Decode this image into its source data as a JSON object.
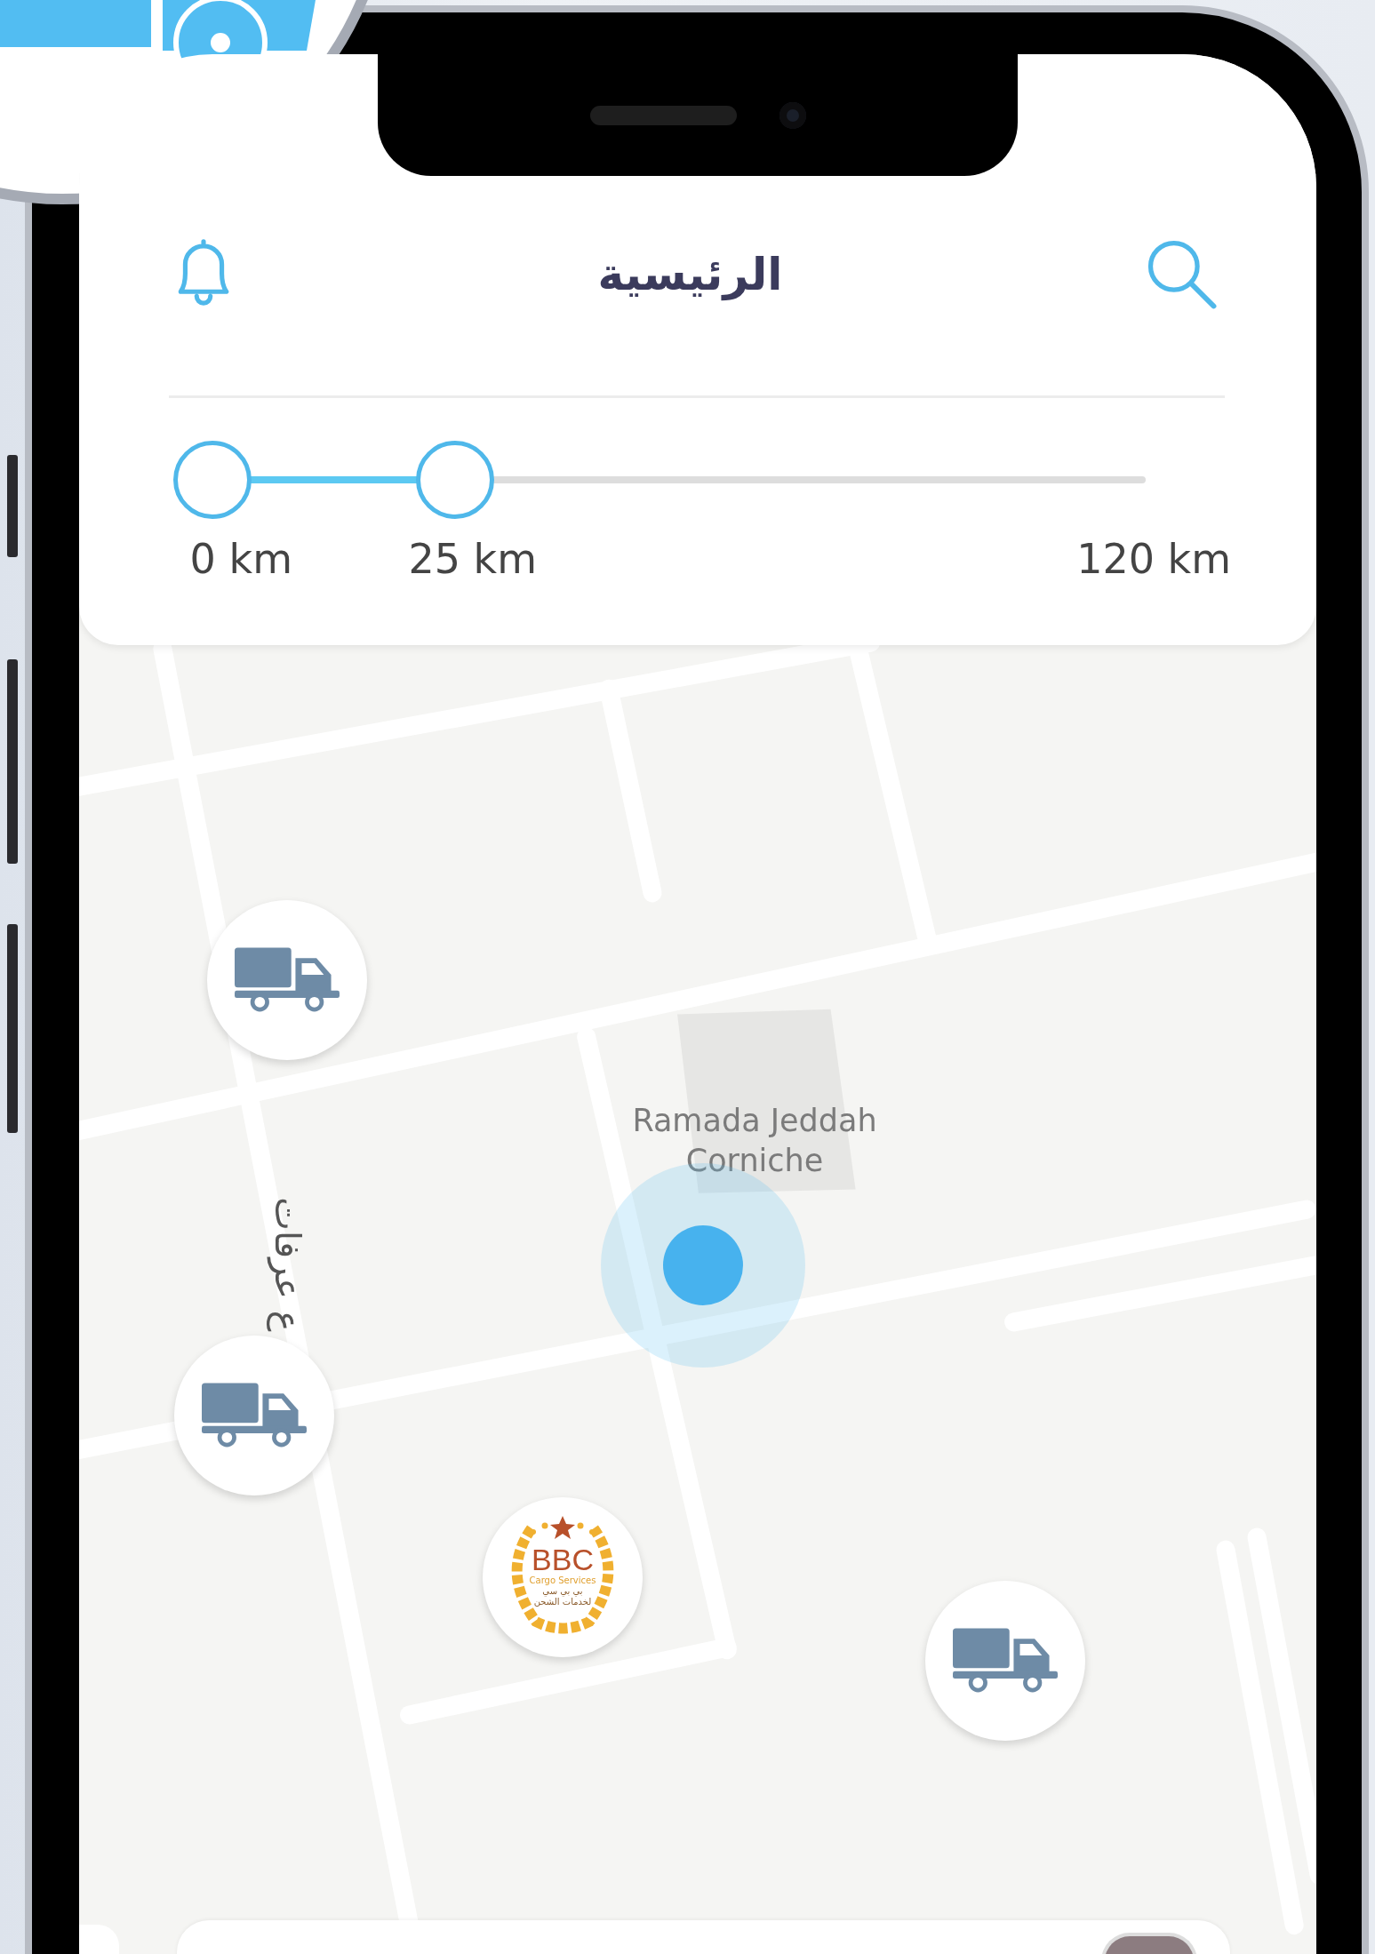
{
  "header": {
    "title": "الرئيسية"
  },
  "distance_slider": {
    "thumbs": [
      {
        "level": 0
      },
      {
        "level": 0.24
      }
    ],
    "scale_labels": [
      "120 km",
      "25 km",
      "0 km"
    ]
  },
  "map": {
    "place_label": "Ramada Jeddah Corniche",
    "street_label": "ع عرفات",
    "markers": [
      {
        "kind": "truck"
      },
      {
        "kind": "truck"
      },
      {
        "kind": "logo",
        "logo_title": "BBC",
        "logo_subtitle": "Cargo Services",
        "logo_lines": [
          "بي بي سي",
          "لخدمات الشحن"
        ]
      },
      {
        "kind": "truck"
      }
    ]
  }
}
